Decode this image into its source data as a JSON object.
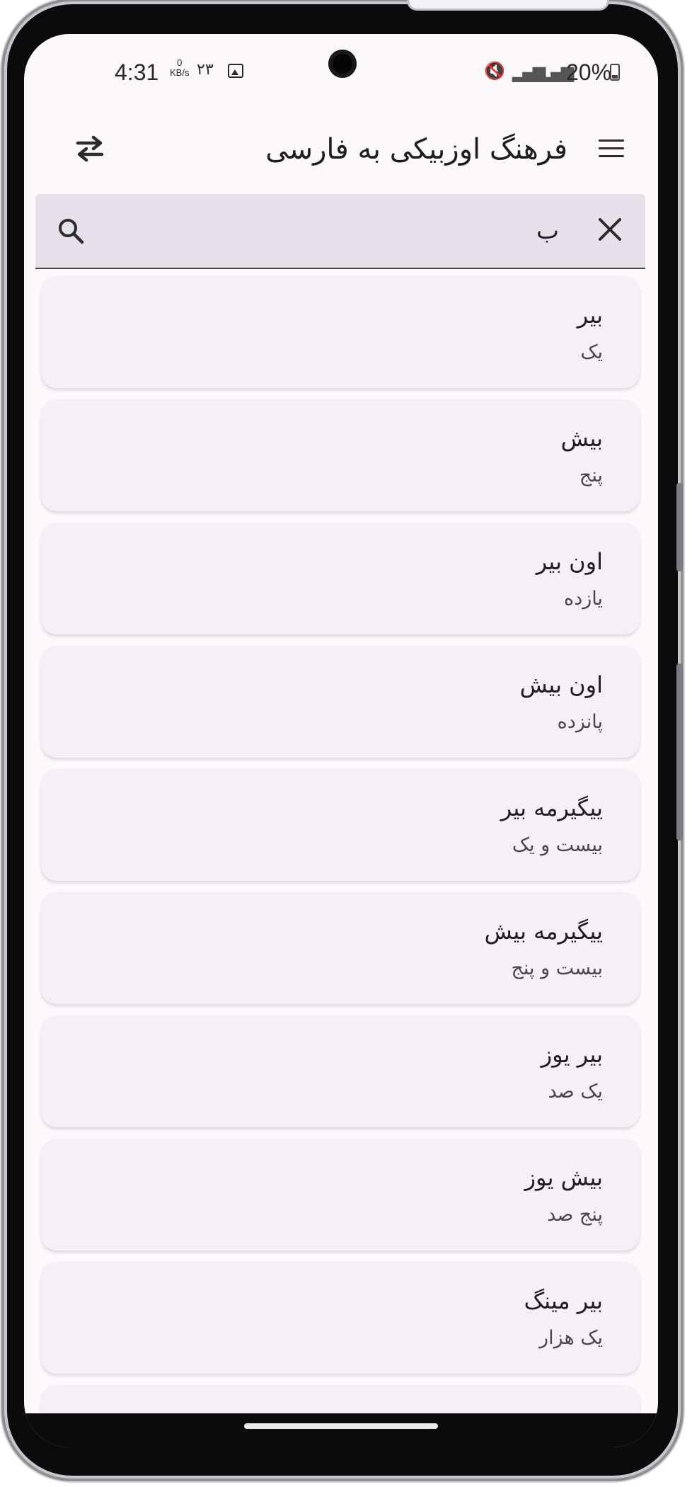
{
  "status_bar": {
    "time": "4:31",
    "net_speed_value": "0",
    "net_speed_unit": "KB/s",
    "date_number": "۲۳",
    "battery_percent": "20%",
    "icons": [
      "gallery-icon",
      "mute-icon",
      "signal-icon",
      "signal-icon",
      "battery-icon"
    ]
  },
  "app_bar": {
    "title": "فرهنگ اوزبیکی به فارسی",
    "menu_icon": "hamburger-menu-icon",
    "swap_icon": "swap-arrows-icon"
  },
  "search": {
    "value": "ب",
    "search_icon": "search-icon",
    "clear_icon": "close-icon"
  },
  "results": [
    {
      "word": "بیر",
      "meaning": "یک"
    },
    {
      "word": "بیش",
      "meaning": "پنج"
    },
    {
      "word": "اون بیر",
      "meaning": "یازده"
    },
    {
      "word": "اون بیش",
      "meaning": "پانزده"
    },
    {
      "word": "ییگیرمه بیر",
      "meaning": "بیست و یک"
    },
    {
      "word": "ییگیرمه بیش",
      "meaning": "بیست و پنج"
    },
    {
      "word": "بیر یوز",
      "meaning": "یک صد"
    },
    {
      "word": "بیش یوز",
      "meaning": "پنج صد"
    },
    {
      "word": "بیر مینگ",
      "meaning": "یک هزار"
    }
  ],
  "colors": {
    "background": "#fdf8fc",
    "card": "#f5eff7",
    "search_field": "#e6e0ea",
    "text": "#1e1e1e"
  }
}
